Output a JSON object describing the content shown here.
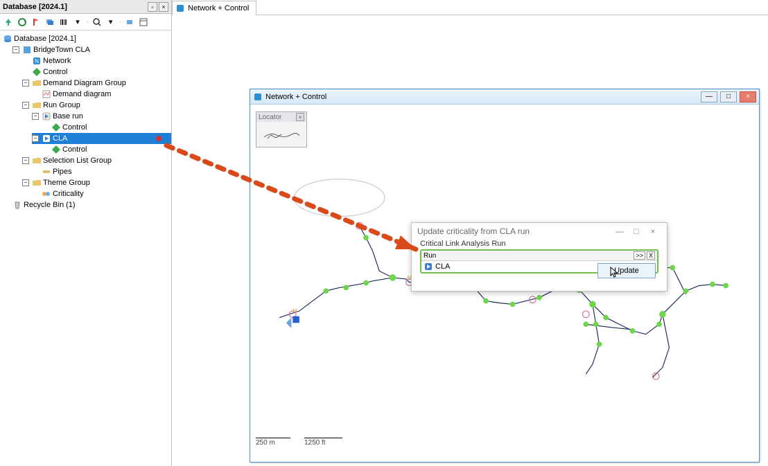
{
  "db_panel": {
    "title": "Database [2024.1]",
    "toolbar_icons": [
      "up-arrow",
      "refresh",
      "flag",
      "layers",
      "barcode",
      "arrow-down",
      "dot",
      "search",
      "dot",
      "layers2",
      "window"
    ],
    "tree": {
      "root": "Database [2024.1]",
      "project": "BridgeTown CLA",
      "network": "Network",
      "control1": "Control",
      "demand_group": "Demand Diagram Group",
      "demand_diagram": "Demand diagram",
      "run_group": "Run Group",
      "base_run": "Base run",
      "control2": "Control",
      "cla": "CLA",
      "control3": "Control",
      "sel_group": "Selection List Group",
      "pipes": "Pipes",
      "theme_group": "Theme Group",
      "criticality": "Criticality",
      "recycle": "Recycle Bin (1)"
    }
  },
  "main_tab": {
    "label": "Network + Control"
  },
  "net_window": {
    "title": "Network + Control"
  },
  "locator": {
    "title": "Locator"
  },
  "scale": {
    "metric": "250 m",
    "imperial": "1250 ft"
  },
  "dialog": {
    "title": "Update criticality from CLA run",
    "group_label": "Critical Link Analysis Run",
    "run_label": "Run",
    "run_value": "CLA",
    "update_btn_prefix": "",
    "update_btn_u": "U",
    "update_btn_rest": "pdate"
  }
}
